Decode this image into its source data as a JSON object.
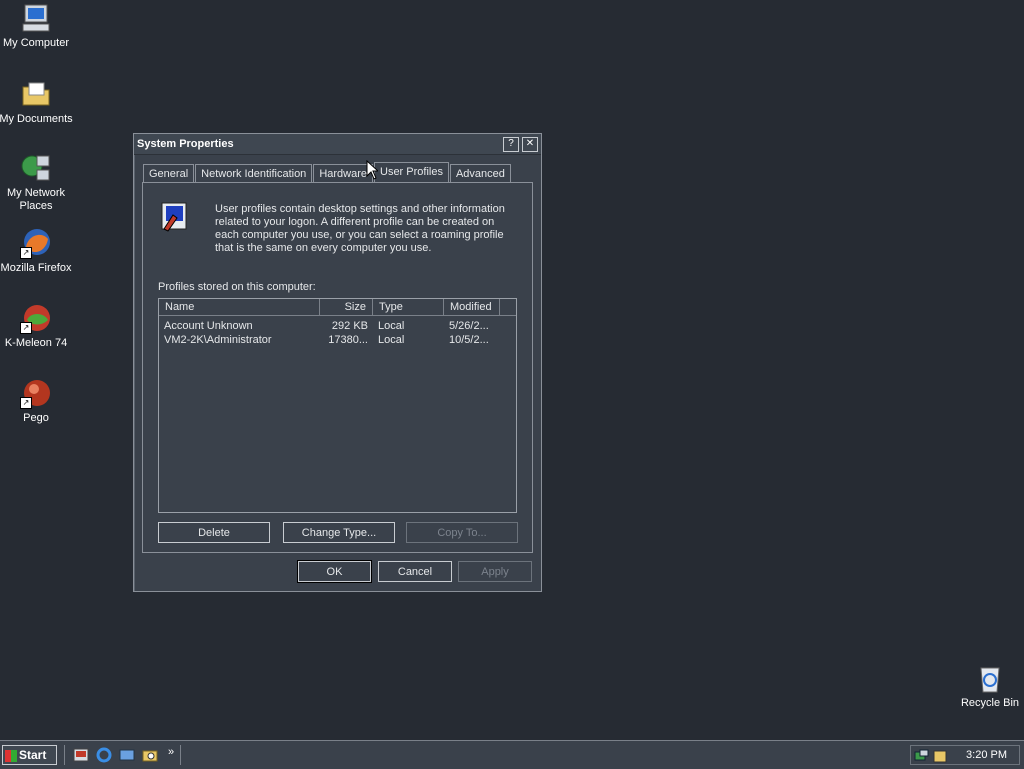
{
  "desktop": {
    "icons": [
      {
        "label": "My Computer",
        "icon": "my-computer-icon"
      },
      {
        "label": "My Documents",
        "icon": "folder-icon"
      },
      {
        "label": "My Network Places",
        "icon": "network-icon"
      },
      {
        "label": "Mozilla Firefox",
        "icon": "firefox-icon"
      },
      {
        "label": "K-Meleon 74",
        "icon": "kmeleon-icon"
      },
      {
        "label": "Pego",
        "icon": "pego-icon"
      },
      {
        "label": "Recycle Bin",
        "icon": "recycle-bin-icon"
      }
    ]
  },
  "dialog": {
    "title": "System Properties",
    "help_label": "?",
    "close_label": "✕",
    "tabs": [
      "General",
      "Network Identification",
      "Hardware",
      "User Profiles",
      "Advanced"
    ],
    "active_tab": "User Profiles",
    "intro": "User profiles contain desktop settings and other information related to your logon.  A different profile can be created on each computer you use, or you can select a roaming profile that is the same on every computer you use.",
    "stored_label": "Profiles stored on this computer:",
    "columns": [
      "Name",
      "Size",
      "Type",
      "Modified"
    ],
    "rows": [
      {
        "name": "Account Unknown",
        "size": "292 KB",
        "type": "Local",
        "modified": "5/26/2..."
      },
      {
        "name": "VM2-2K\\Administrator",
        "size": "17380...",
        "type": "Local",
        "modified": "10/5/2..."
      }
    ],
    "buttons": {
      "delete": "Delete",
      "change_type": "Change Type...",
      "copy_to": "Copy To...",
      "ok": "OK",
      "cancel": "Cancel",
      "apply": "Apply"
    }
  },
  "taskbar": {
    "start_label": "Start",
    "chevron": "»",
    "clock": "3:20 PM"
  },
  "colors": {
    "desktop": "#262b33",
    "window": "#3a414b",
    "border": "#8a9099"
  }
}
